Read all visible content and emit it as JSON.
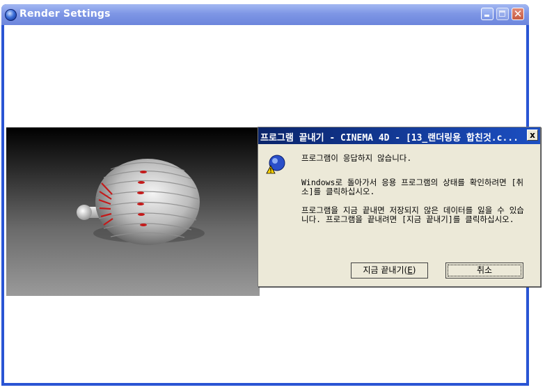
{
  "window": {
    "title": "Render Settings",
    "icon": "cinema4d-app-icon",
    "controls": {
      "close": "✕"
    }
  },
  "dialog": {
    "title": "프로그램 끝내기 - CINEMA 4D - [13_랜더링용 합친것.c...",
    "close": "x",
    "icon": "warning-app-icon",
    "message1": "프로그램이 응답하지 않습니다.",
    "message2": "Windows로 돌아가서 응용 프로그램의 상태를 확인하려면 [취소]를 클릭하십시오.",
    "message3": "프로그램을 지금 끝내면 저장되지 않은 데이터를 잃을 수 있습니다. 프로그램을 끝내려면 [지금 끝내기]를 클릭하십시오.",
    "end_now_button": "지금 끝내기(",
    "end_now_mnemonic": "E",
    "end_now_suffix": ")",
    "cancel_button": "취소"
  },
  "colors": {
    "title_bar": "#7e96e5",
    "dialog_title": "#0a246a",
    "dialog_bg": "#ece9d8",
    "sphere_accent": "#c41a1a"
  }
}
